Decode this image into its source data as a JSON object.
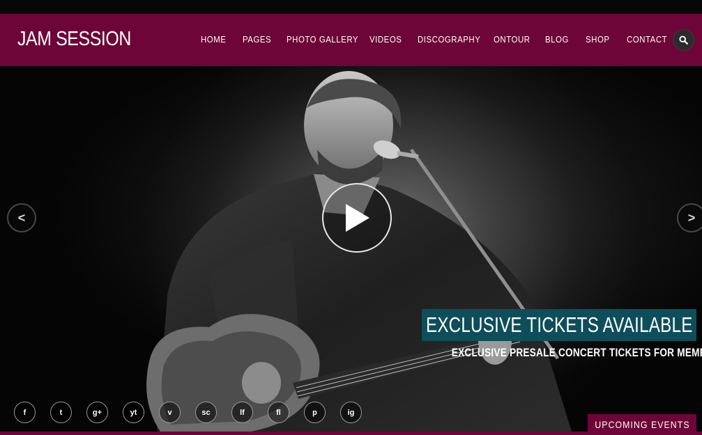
{
  "site": {
    "logo": "JAM SESSION"
  },
  "nav": {
    "items": [
      {
        "label": "HOME"
      },
      {
        "label": "PAGES"
      },
      {
        "label": "PHOTO GALLERY"
      },
      {
        "label": "VIDEOS"
      },
      {
        "label": "DISCOGRAPHY"
      },
      {
        "label": "ONTOUR"
      },
      {
        "label": "BLOG"
      },
      {
        "label": "SHOP"
      },
      {
        "label": "CONTACT"
      }
    ],
    "search_icon": "search-icon"
  },
  "slider": {
    "title": "EXCLUSIVE TICKETS AVAILABLE",
    "subtitle": "EXCLUSIVE PRESALE CONCERT TICKETS FOR MEMBERS ONLY",
    "prev_label": "<",
    "next_label": ">",
    "play_icon": "play-icon"
  },
  "social": [
    {
      "name": "facebook-icon",
      "glyph": "f"
    },
    {
      "name": "twitter-icon",
      "glyph": "t"
    },
    {
      "name": "google-plus-icon",
      "glyph": "g+"
    },
    {
      "name": "youtube-icon",
      "glyph": "yt"
    },
    {
      "name": "vimeo-icon",
      "glyph": "v"
    },
    {
      "name": "soundcloud-icon",
      "glyph": "sc"
    },
    {
      "name": "lastfm-icon",
      "glyph": "lf"
    },
    {
      "name": "flickr-icon",
      "glyph": "fl"
    },
    {
      "name": "pinterest-icon",
      "glyph": "p"
    },
    {
      "name": "instagram-icon",
      "glyph": "ig"
    }
  ],
  "upcoming": {
    "label": "UPCOMING EVENTS"
  },
  "colors": {
    "brand": "#6d0538",
    "caption_bg": "#0d4e5a",
    "background": "#000000"
  }
}
